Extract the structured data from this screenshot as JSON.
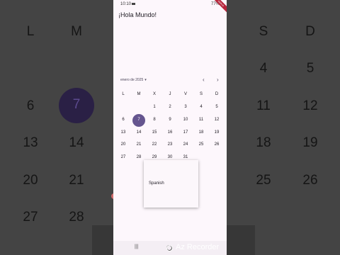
{
  "status_bar": {
    "time": "10:10",
    "battery": "77%"
  },
  "app": {
    "title": "¡Hola Mundo!",
    "debug_label": "DEBUG"
  },
  "calendar": {
    "month_label": "enero de 2025",
    "prev_label": "‹",
    "next_label": "›",
    "weekdays": [
      "L",
      "M",
      "X",
      "J",
      "V",
      "S",
      "D"
    ],
    "selected_day": "7",
    "weeks": [
      [
        "",
        "",
        "1",
        "2",
        "3",
        "4",
        "5"
      ],
      [
        "6",
        "7",
        "8",
        "9",
        "10",
        "11",
        "12"
      ],
      [
        "13",
        "14",
        "15",
        "16",
        "17",
        "18",
        "19"
      ],
      [
        "20",
        "21",
        "22",
        "23",
        "24",
        "25",
        "26"
      ],
      [
        "27",
        "28",
        "29",
        "30",
        "31",
        "",
        ""
      ]
    ]
  },
  "popup": {
    "items": [
      "Spanish"
    ]
  },
  "bg": {
    "weekdays": [
      "L",
      "M",
      "S",
      "D"
    ],
    "numbers": [
      "4",
      "5",
      "6",
      "7",
      "11",
      "12",
      "13",
      "14",
      "18",
      "19",
      "20",
      "21",
      "25",
      "26",
      "27",
      "28"
    ]
  },
  "overlay": {
    "recorder_label": "Az Recorder"
  },
  "navbar": {
    "menu_glyph": "|||"
  }
}
